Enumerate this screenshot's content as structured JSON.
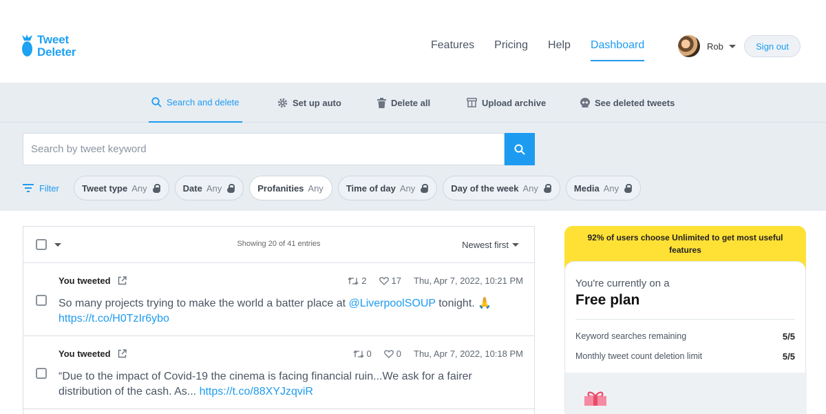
{
  "brand": {
    "line1": "Tweet",
    "line2": "Deleter",
    "color": "#1da1f2"
  },
  "nav": [
    {
      "label": "Features",
      "active": false
    },
    {
      "label": "Pricing",
      "active": false
    },
    {
      "label": "Help",
      "active": false
    },
    {
      "label": "Dashboard",
      "active": true
    }
  ],
  "user": {
    "name": "Rob",
    "sign_out": "Sign out"
  },
  "tabs": [
    {
      "label": "Search and delete",
      "icon": "search-icon",
      "active": true
    },
    {
      "label": "Set up auto",
      "icon": "gear-icon",
      "active": false
    },
    {
      "label": "Delete all",
      "icon": "trash-icon",
      "active": false
    },
    {
      "label": "Upload archive",
      "icon": "archive-icon",
      "active": false
    },
    {
      "label": "See deleted tweets",
      "icon": "skull-icon",
      "active": false
    }
  ],
  "search": {
    "placeholder": "Search by tweet keyword"
  },
  "filter": {
    "label": "Filter",
    "chips": [
      {
        "name": "Tweet type",
        "value": "Any",
        "locked": true
      },
      {
        "name": "Date",
        "value": "Any",
        "locked": true
      },
      {
        "name": "Profanities",
        "value": "Any",
        "locked": false
      },
      {
        "name": "Time of day",
        "value": "Any",
        "locked": true
      },
      {
        "name": "Day of the week",
        "value": "Any",
        "locked": true
      },
      {
        "name": "Media",
        "value": "Any",
        "locked": true
      }
    ]
  },
  "list": {
    "showing": "Showing 20 of 41 entries",
    "sort": "Newest first",
    "tweets": [
      {
        "who": "You tweeted",
        "retweets": "2",
        "likes": "17",
        "date": "Thu, Apr 7, 2022, 10:21 PM",
        "text_before": "So many projects trying to make the world a batter place at ",
        "mention": "@LiverpoolSOUP",
        "text_after": " tonight. 🙏",
        "url": "https://t.co/H0TzIr6ybo"
      },
      {
        "who": "You tweeted",
        "retweets": "0",
        "likes": "0",
        "date": "Thu, Apr 7, 2022, 10:18 PM",
        "text_before": "“Due to the impact of Covid-19 the cinema is facing financial ruin...We ask for a fairer distribution of the cash. As... ",
        "mention": "",
        "text_after": "",
        "url": "https://t.co/88XYJzqviR"
      }
    ]
  },
  "panel": {
    "promo": "92% of users choose Unlimited to get most useful features",
    "current_sub": "You're currently on a",
    "plan": "Free plan",
    "stats": [
      {
        "label": "Keyword searches remaining",
        "value": "5/5"
      },
      {
        "label": "Monthly tweet count deletion limit",
        "value": "5/5"
      }
    ]
  },
  "colors": {
    "accent": "#1d9bf0",
    "promo": "#ffe135",
    "band": "#e8edf2"
  }
}
